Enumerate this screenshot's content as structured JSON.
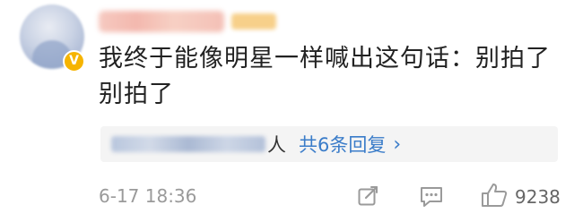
{
  "comment": {
    "text": "我终于能像明星一样喊出这句话：别拍了别拍了",
    "verified_badge": "V"
  },
  "replies": {
    "suffix": "人",
    "count_text": "共6条回复",
    "chevron": "›"
  },
  "footer": {
    "timestamp": "6-17 18:36",
    "like_count": "9238",
    "icons": [
      "edit-icon",
      "comment-icon",
      "thumbs-up-icon"
    ]
  },
  "colors": {
    "link": "#3a7cc9",
    "text": "#222222",
    "meta": "#9a9a9a",
    "reply_bg": "#f4f4f4",
    "badge": "#f6b400"
  }
}
